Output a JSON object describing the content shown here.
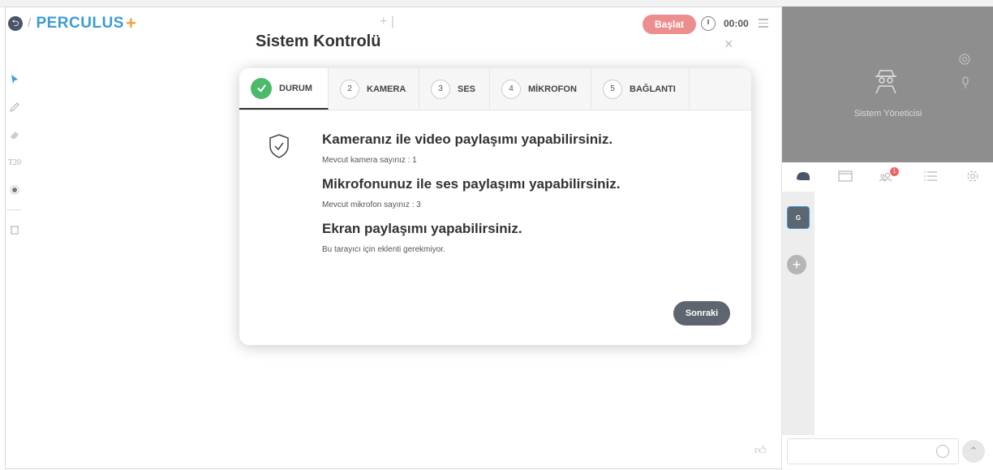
{
  "header": {
    "brand": "PERCULUS",
    "brand_plus": "+",
    "start_label": "Başlat",
    "timer": "00:00"
  },
  "video": {
    "user_name": "Sistem Yöneticisi"
  },
  "right_tabs": {
    "participants_badge": "1"
  },
  "chat": {
    "group_label": "G"
  },
  "modal": {
    "title": "Sistem Kontrolü",
    "steps": [
      {
        "num": "",
        "label": "DURUM"
      },
      {
        "num": "2",
        "label": "KAMERA"
      },
      {
        "num": "3",
        "label": "SES"
      },
      {
        "num": "4",
        "label": "MİKROFON"
      },
      {
        "num": "5",
        "label": "BAĞLANTI"
      }
    ],
    "camera_heading": "Kameranız ile video paylaşımı yapabilirsiniz.",
    "camera_sub": "Mevcut kamera sayınız : 1",
    "mic_heading": "Mikrofonunuz ile ses paylaşımı yapabilirsiniz.",
    "mic_sub": "Mevcut mikrofon sayınız : 3",
    "screen_heading": "Ekran paylaşımı yapabilirsiniz.",
    "screen_sub": "Bu tarayıcı için eklenti gerekmiyor.",
    "next_label": "Sonraki"
  },
  "tools": {
    "text_size": "T20"
  },
  "colors": {
    "brand_blue": "#3d9bd6",
    "brand_orange": "#f2a33a",
    "start_red": "#ec8e8e",
    "success_green": "#4cba6b",
    "button_gray": "#5d666f"
  }
}
